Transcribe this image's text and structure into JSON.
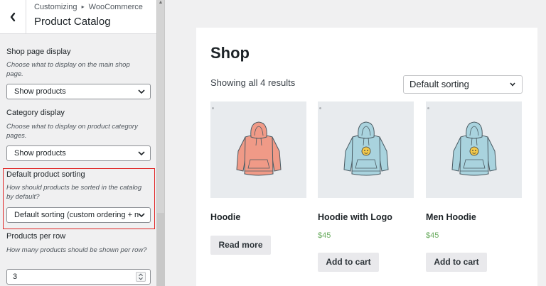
{
  "sidebar": {
    "breadcrumb_parent": "Customizing",
    "breadcrumb_separator": "▸",
    "breadcrumb_current": "WooCommerce",
    "title": "Product Catalog",
    "shop_page_display": {
      "label": "Shop page display",
      "description": "Choose what to display on the main shop page.",
      "value": "Show products"
    },
    "category_display": {
      "label": "Category display",
      "description": "Choose what to display on product category pages.",
      "value": "Show products"
    },
    "default_sorting": {
      "label": "Default product sorting",
      "description": "How should products be sorted in the catalog by default?",
      "value": "Default sorting (custom ordering + n"
    },
    "products_per_row": {
      "label": "Products per row",
      "description": "How many products should be shown per row?",
      "value": "3"
    }
  },
  "shop": {
    "title": "Shop",
    "result_count": "Showing all 4 results",
    "sort_value": "Default sorting",
    "products": [
      {
        "name": "Hoodie",
        "price": "",
        "button": "Read more",
        "color": "#f09a87",
        "logo": false
      },
      {
        "name": "Hoodie with Logo",
        "price": "$45",
        "button": "Add to cart",
        "color": "#a9d3de",
        "logo": true
      },
      {
        "name": "Men Hoodie",
        "price": "$45",
        "button": "Add to cart",
        "color": "#a9d3de",
        "logo": true
      }
    ]
  },
  "colors": {
    "highlight": "#e02424",
    "price": "#6bac60"
  },
  "icons": {
    "back": "chevron-left-icon",
    "select": "chevron-down-icon",
    "spinner": "spinner-icon",
    "product": "hoodie-icon"
  }
}
